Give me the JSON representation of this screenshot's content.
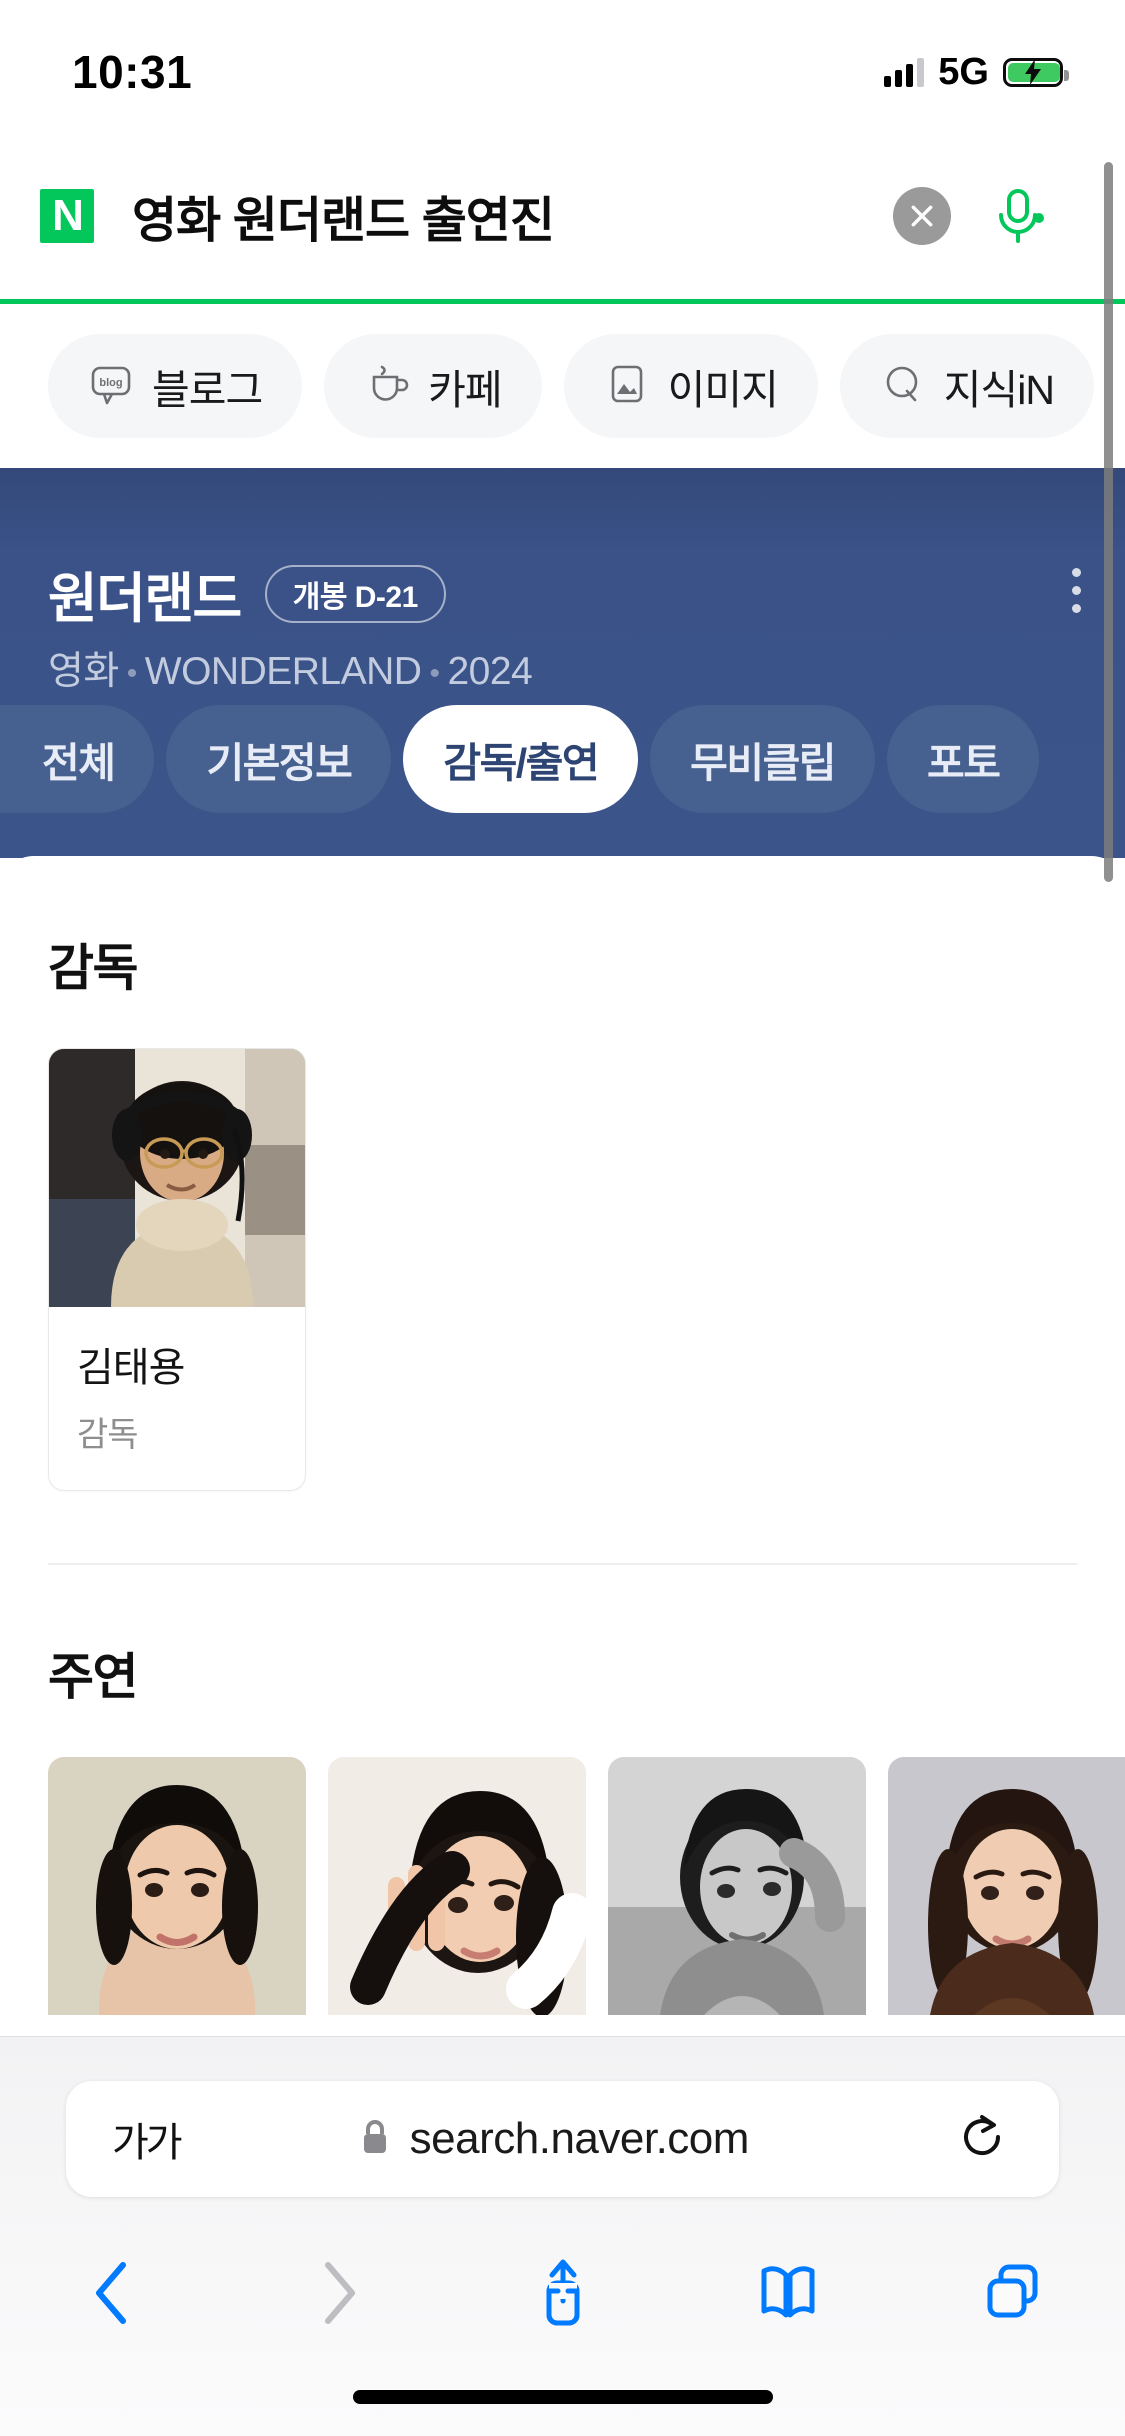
{
  "status_bar": {
    "time": "10:31",
    "network": "5G",
    "signal_icon": "cellular-signal-icon",
    "battery_icon": "battery-charging-icon"
  },
  "search_header": {
    "logo": "naver-n-logo",
    "query": "영화 원더랜드 출연진",
    "clear_icon": "close-icon",
    "mic_icon": "microphone-icon",
    "accent_color": "#03C75A"
  },
  "filter_chips": [
    {
      "label": "블로그",
      "icon": "blog-icon"
    },
    {
      "label": "카페",
      "icon": "cup-icon"
    },
    {
      "label": "이미지",
      "icon": "image-icon"
    },
    {
      "label": "지식iN",
      "icon": "question-icon"
    }
  ],
  "movie_header": {
    "title": "원더랜드",
    "badge": "개봉 D-21",
    "subtitle_parts": [
      "영화",
      "WONDERLAND",
      "2024"
    ],
    "subtitle": "영화 · WONDERLAND · 2024",
    "menu_icon": "kebab-menu-icon",
    "background_color": "#3b5489"
  },
  "tabs": [
    {
      "label": "전체",
      "active": false
    },
    {
      "label": "기본정보",
      "active": false
    },
    {
      "label": "감독/출연",
      "active": true
    },
    {
      "label": "무비클립",
      "active": false
    },
    {
      "label": "포토",
      "active": false
    }
  ],
  "content": {
    "director_section": {
      "heading": "감독",
      "people": [
        {
          "name": "김태용",
          "role": "감독",
          "photo": "director-portrait"
        }
      ]
    },
    "cast_section": {
      "heading": "주연",
      "people": [
        {
          "photo": "actor-portrait-1"
        },
        {
          "photo": "actor-portrait-2"
        },
        {
          "photo": "actor-portrait-3"
        },
        {
          "photo": "actor-portrait-4"
        }
      ]
    }
  },
  "safari_bar": {
    "text_size_label": "가가",
    "lock_icon": "lock-icon",
    "url": "search.naver.com",
    "reload_icon": "reload-icon",
    "toolbar": [
      {
        "name": "back-button",
        "icon": "chevron-left-icon",
        "enabled": true
      },
      {
        "name": "forward-button",
        "icon": "chevron-right-icon",
        "enabled": false
      },
      {
        "name": "share-button",
        "icon": "share-icon",
        "enabled": true
      },
      {
        "name": "bookmarks-button",
        "icon": "book-icon",
        "enabled": true
      },
      {
        "name": "tabs-button",
        "icon": "tabs-icon",
        "enabled": true
      }
    ],
    "accent_color": "#007AFF"
  }
}
